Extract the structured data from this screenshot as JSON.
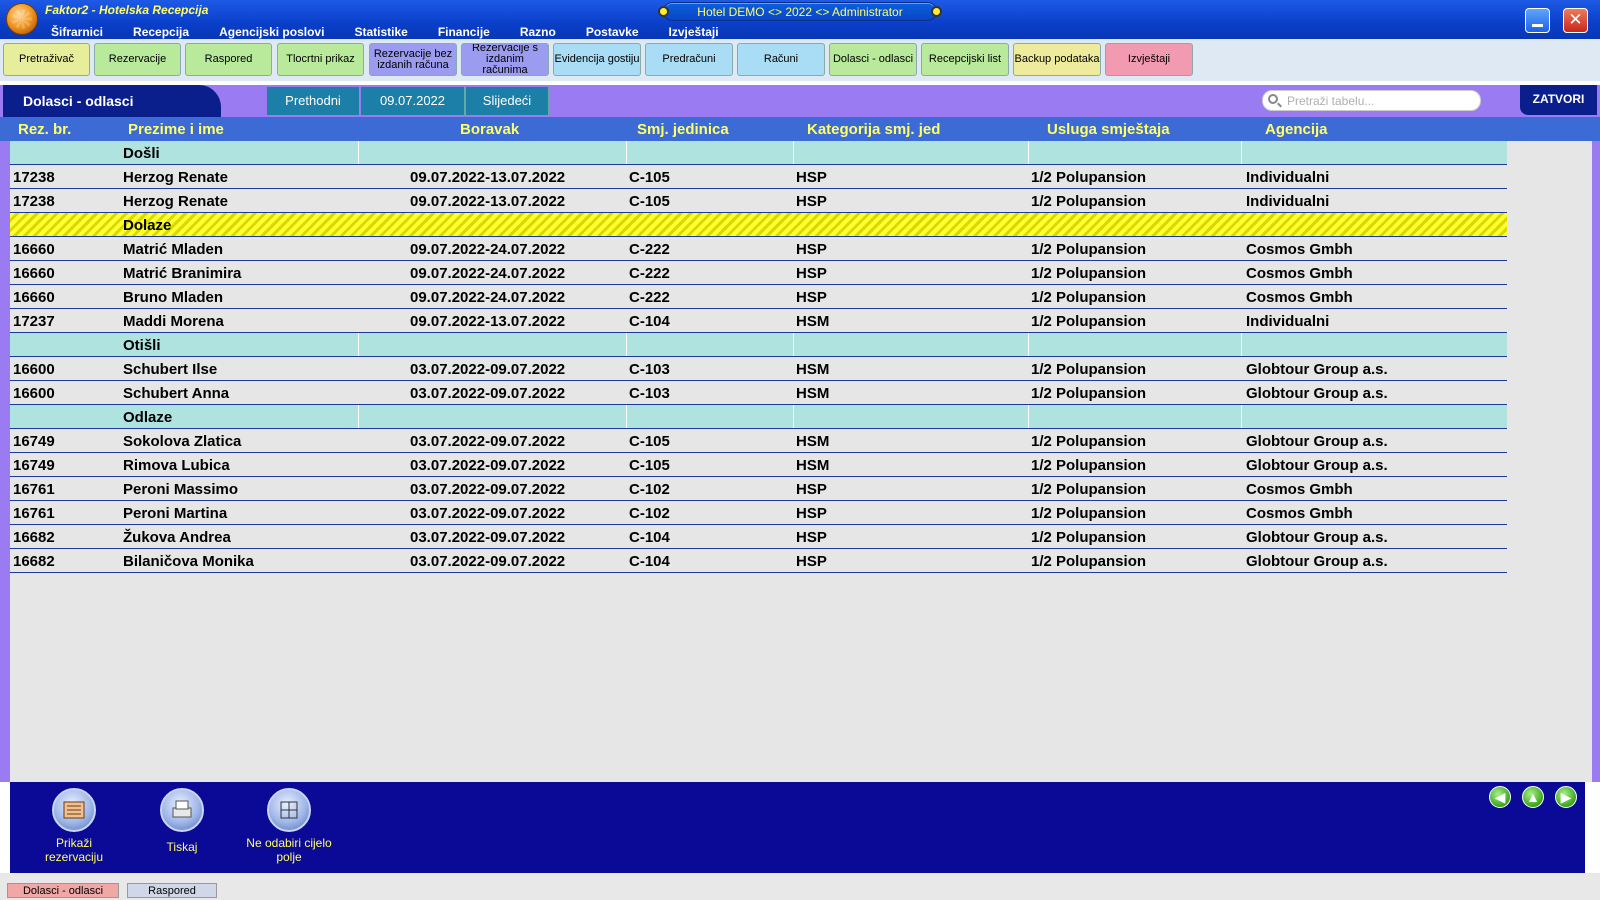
{
  "app": {
    "title": "Faktor2 - Hotelska Recepcija",
    "hotel_info": "Hotel DEMO <> 2022 <> Administrator"
  },
  "menu": [
    "Šifrarnici",
    "Recepcija",
    "Agencijski poslovi",
    "Statistike",
    "Financije",
    "Razno",
    "Postavke",
    "Izvještaji"
  ],
  "toolbar": [
    {
      "label": "Pretraživač",
      "color": "#e6ee9c"
    },
    {
      "label": "Rezervacije",
      "color": "#b9ea9c"
    },
    {
      "label": "Raspored",
      "color": "#b9ea9c"
    },
    {
      "label": "Tlocrtni prikaz",
      "color": "#b9ea9c"
    },
    {
      "label": "Rezervacije bez izdanih računa",
      "color": "#9b9cf0"
    },
    {
      "label": "Rezervacije s izdanim računima",
      "color": "#9b9cf0"
    },
    {
      "label": "Evidencija gostiju",
      "color": "#a9dcf5"
    },
    {
      "label": "Predračuni",
      "color": "#a9dcf5"
    },
    {
      "label": "Računi",
      "color": "#a9dcf5"
    },
    {
      "label": "Dolasci - odlasci",
      "color": "#b9ea9c"
    },
    {
      "label": "Recepcijski list",
      "color": "#b9ea9c"
    },
    {
      "label": "Backup podataka",
      "color": "#eeec9c"
    },
    {
      "label": "Izvještaji",
      "color": "#f29ab0"
    }
  ],
  "page": {
    "title": "Dolasci - odlasci",
    "prev_label": "Prethodni",
    "date": "09.07.2022",
    "next_label": "Slijedeći",
    "search_placeholder": "Pretraži tabelu...",
    "close_label": "ZATVORI"
  },
  "columns": [
    "Rez. br.",
    "Prezime i ime",
    "Boravak",
    "Smj. jedinica",
    "Kategorija smj. jed",
    "Usluga smještaja",
    "Agencija"
  ],
  "rows": [
    {
      "group": "Došli",
      "style": "teal"
    },
    {
      "rez": "17238",
      "name": "Herzog Renate",
      "stay": "09.07.2022-13.07.2022",
      "unit": "C-105",
      "cat": "HSP",
      "service": "1/2 Polupansion",
      "agency": "Individualni"
    },
    {
      "rez": "17238",
      "name": "Herzog Renate",
      "stay": "09.07.2022-13.07.2022",
      "unit": "C-105",
      "cat": "HSP",
      "service": "1/2 Polupansion",
      "agency": "Individualni"
    },
    {
      "group": "Dolaze",
      "style": "yellow"
    },
    {
      "rez": "16660",
      "name": "Matrić Mladen",
      "stay": "09.07.2022-24.07.2022",
      "unit": "C-222",
      "cat": "HSP",
      "service": "1/2 Polupansion",
      "agency": "Cosmos Gmbh"
    },
    {
      "rez": "16660",
      "name": "Matrić Branimira",
      "stay": "09.07.2022-24.07.2022",
      "unit": "C-222",
      "cat": "HSP",
      "service": "1/2 Polupansion",
      "agency": "Cosmos Gmbh"
    },
    {
      "rez": "16660",
      "name": "Bruno Mladen",
      "stay": "09.07.2022-24.07.2022",
      "unit": "C-222",
      "cat": "HSP",
      "service": "1/2 Polupansion",
      "agency": "Cosmos Gmbh"
    },
    {
      "rez": "17237",
      "name": "Maddi Morena",
      "stay": "09.07.2022-13.07.2022",
      "unit": "C-104",
      "cat": "HSM",
      "service": "1/2 Polupansion",
      "agency": "Individualni"
    },
    {
      "group": "Otišli",
      "style": "teal"
    },
    {
      "rez": "16600",
      "name": "Schubert Ilse",
      "stay": "03.07.2022-09.07.2022",
      "unit": "C-103",
      "cat": "HSM",
      "service": "1/2 Polupansion",
      "agency": "Globtour Group a.s."
    },
    {
      "rez": "16600",
      "name": "Schubert Anna",
      "stay": "03.07.2022-09.07.2022",
      "unit": "C-103",
      "cat": "HSM",
      "service": "1/2 Polupansion",
      "agency": "Globtour Group a.s."
    },
    {
      "group": "Odlaze",
      "style": "teal"
    },
    {
      "rez": "16749",
      "name": "Sokolova Zlatica",
      "stay": "03.07.2022-09.07.2022",
      "unit": "C-105",
      "cat": "HSM",
      "service": "1/2 Polupansion",
      "agency": "Globtour Group a.s."
    },
    {
      "rez": "16749",
      "name": "Rimova Lubica",
      "stay": "03.07.2022-09.07.2022",
      "unit": "C-105",
      "cat": "HSM",
      "service": "1/2 Polupansion",
      "agency": "Globtour Group a.s."
    },
    {
      "rez": "16761",
      "name": "Peroni Massimo",
      "stay": "03.07.2022-09.07.2022",
      "unit": "C-102",
      "cat": "HSP",
      "service": "1/2 Polupansion",
      "agency": "Cosmos Gmbh"
    },
    {
      "rez": "16761",
      "name": "Peroni Martina",
      "stay": "03.07.2022-09.07.2022",
      "unit": "C-102",
      "cat": "HSP",
      "service": "1/2 Polupansion",
      "agency": "Cosmos Gmbh"
    },
    {
      "rez": "16682",
      "name": "Žukova Andrea",
      "stay": "03.07.2022-09.07.2022",
      "unit": "C-104",
      "cat": "HSP",
      "service": "1/2 Polupansion",
      "agency": "Globtour Group a.s."
    },
    {
      "rez": "16682",
      "name": "Bilaničova Monika",
      "stay": "03.07.2022-09.07.2022",
      "unit": "C-104",
      "cat": "HSP",
      "service": "1/2 Polupansion",
      "agency": "Globtour Group a.s."
    }
  ],
  "actions": [
    {
      "label": "Prikaži rezervaciju",
      "icon": "reservation-book-icon"
    },
    {
      "label": "Tiskaj",
      "icon": "printer-icon"
    },
    {
      "label": "Ne odabiri cijelo polje",
      "icon": "grid-select-icon"
    }
  ],
  "nav_arrows": [
    "arrow-left-icon",
    "arrow-up-icon",
    "arrow-right-icon"
  ],
  "status_tabs": [
    "Dolasci - odlasci",
    "Raspored"
  ]
}
